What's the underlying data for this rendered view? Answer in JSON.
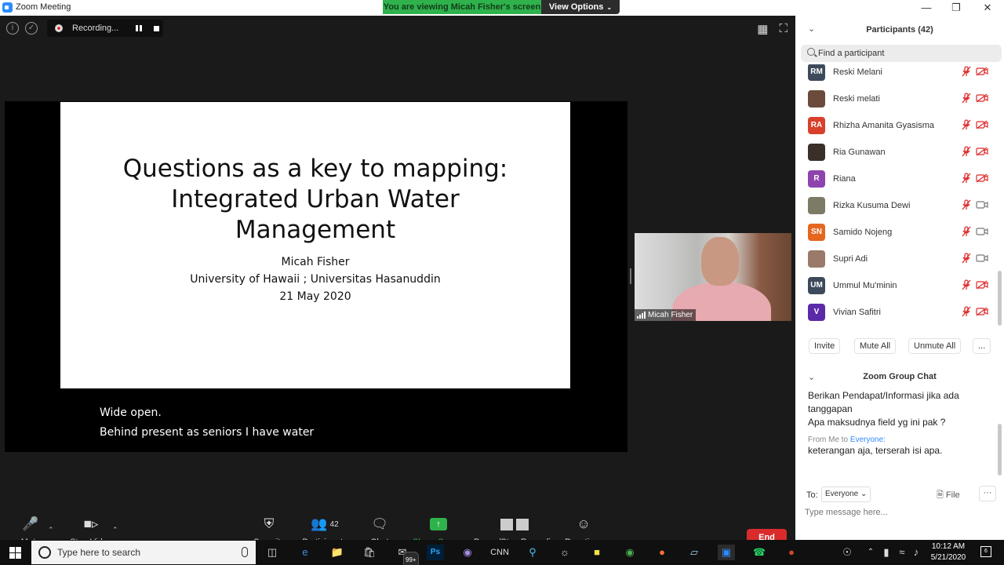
{
  "window": {
    "title": "Zoom Meeting"
  },
  "banner": {
    "viewing_text": "You are viewing Micah Fisher's screen",
    "view_options": "View Options"
  },
  "recording": {
    "label": "Recording..."
  },
  "slide": {
    "heading": [
      "Questions as a key to mapping:",
      "Integrated Urban Water",
      "Management"
    ],
    "author": "Micah Fisher",
    "affiliation": "University of Hawaii ; Universitas Hasanuddin",
    "date": "21 May 2020"
  },
  "captions": [
    "Wide open.",
    "Behind present as seniors I have water"
  ],
  "video": {
    "name": "Micah Fisher"
  },
  "toolbar": {
    "mute": "Mute",
    "stop_video": "Stop Video",
    "security": "Security",
    "participants": "Participants",
    "participants_count": "42",
    "chat": "Chat",
    "share_screen": "Share Screen",
    "pause_stop_recording": "Pause/Stop Recording",
    "reactions": "Reactions",
    "end": "End"
  },
  "participants_panel": {
    "title": "Participants (42)",
    "search_placeholder": "Find a participant",
    "invite": "Invite",
    "mute_all": "Mute All",
    "unmute_all": "Unmute All",
    "more": "...",
    "items": [
      {
        "initials": "RM",
        "name": "Reski Melani",
        "avatar_color": "#3d4a5c",
        "video_off": true
      },
      {
        "initials": "",
        "name": "Reski melati",
        "avatar_color": "#6a4b3c",
        "video_off": true
      },
      {
        "initials": "RA",
        "name": "Rhizha Amanita Gyasisma",
        "avatar_color": "#d8402b",
        "video_off": true
      },
      {
        "initials": "",
        "name": "Ria Gunawan",
        "avatar_color": "#3b2f2a",
        "video_off": true
      },
      {
        "initials": "R",
        "name": "Riana",
        "avatar_color": "#8e44ad",
        "video_off": true
      },
      {
        "initials": "",
        "name": "Rizka Kusuma Dewi",
        "avatar_color": "#7d7a66",
        "video_off": false
      },
      {
        "initials": "SN",
        "name": "Samido Nojeng",
        "avatar_color": "#e5661f",
        "video_off": false
      },
      {
        "initials": "",
        "name": "Supri Adi",
        "avatar_color": "#9a7a6a",
        "video_off": false
      },
      {
        "initials": "UM",
        "name": "Ummul Mu'minin",
        "avatar_color": "#3d4a5c",
        "video_off": true
      },
      {
        "initials": "V",
        "name": "Vivian Safitri",
        "avatar_color": "#5b2aa8",
        "video_off": true
      }
    ]
  },
  "chat": {
    "title": "Zoom Group Chat",
    "messages": [
      "Berikan Pendapat/Informasi jika ada tanggapan",
      "Apa maksudnya field yg ini pak ?"
    ],
    "from_label": "From Me to",
    "from_target": "Everyone:",
    "my_message": "keterangan aja, terserah isi apa.",
    "to_label": "To:",
    "to_value": "Everyone",
    "file": "File",
    "more": "···",
    "input_placeholder": "Type message here..."
  },
  "taskbar": {
    "search_placeholder": "Type here to search",
    "mail_badge": "99+",
    "cnn": "CNN",
    "time": "10:12 AM",
    "date": "5/21/2020",
    "notif_count": "6"
  }
}
